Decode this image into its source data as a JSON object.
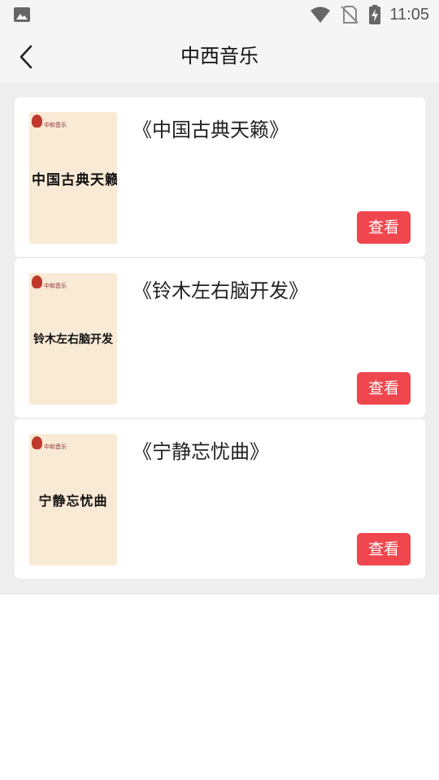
{
  "status_bar": {
    "time": "11:05",
    "icons": [
      "gallery-icon",
      "wifi-icon",
      "no-sim-icon",
      "battery-charging-icon"
    ]
  },
  "header": {
    "title": "中西音乐",
    "back_icon": "chevron-left-icon"
  },
  "cover_brand": "中和音乐",
  "items": [
    {
      "title": "《中国古典天籁》",
      "cover_text": "中国古典天籁",
      "button_label": "查看"
    },
    {
      "title": "《铃木左右脑开发》",
      "cover_text": "铃木左右脑开发",
      "button_label": "查看"
    },
    {
      "title": "《宁静忘忧曲》",
      "cover_text": "宁静忘忧曲",
      "button_label": "查看"
    }
  ],
  "colors": {
    "accent": "#f0474f",
    "cover_bg": "#f8ead5",
    "page_bg": "#eeeeee"
  }
}
